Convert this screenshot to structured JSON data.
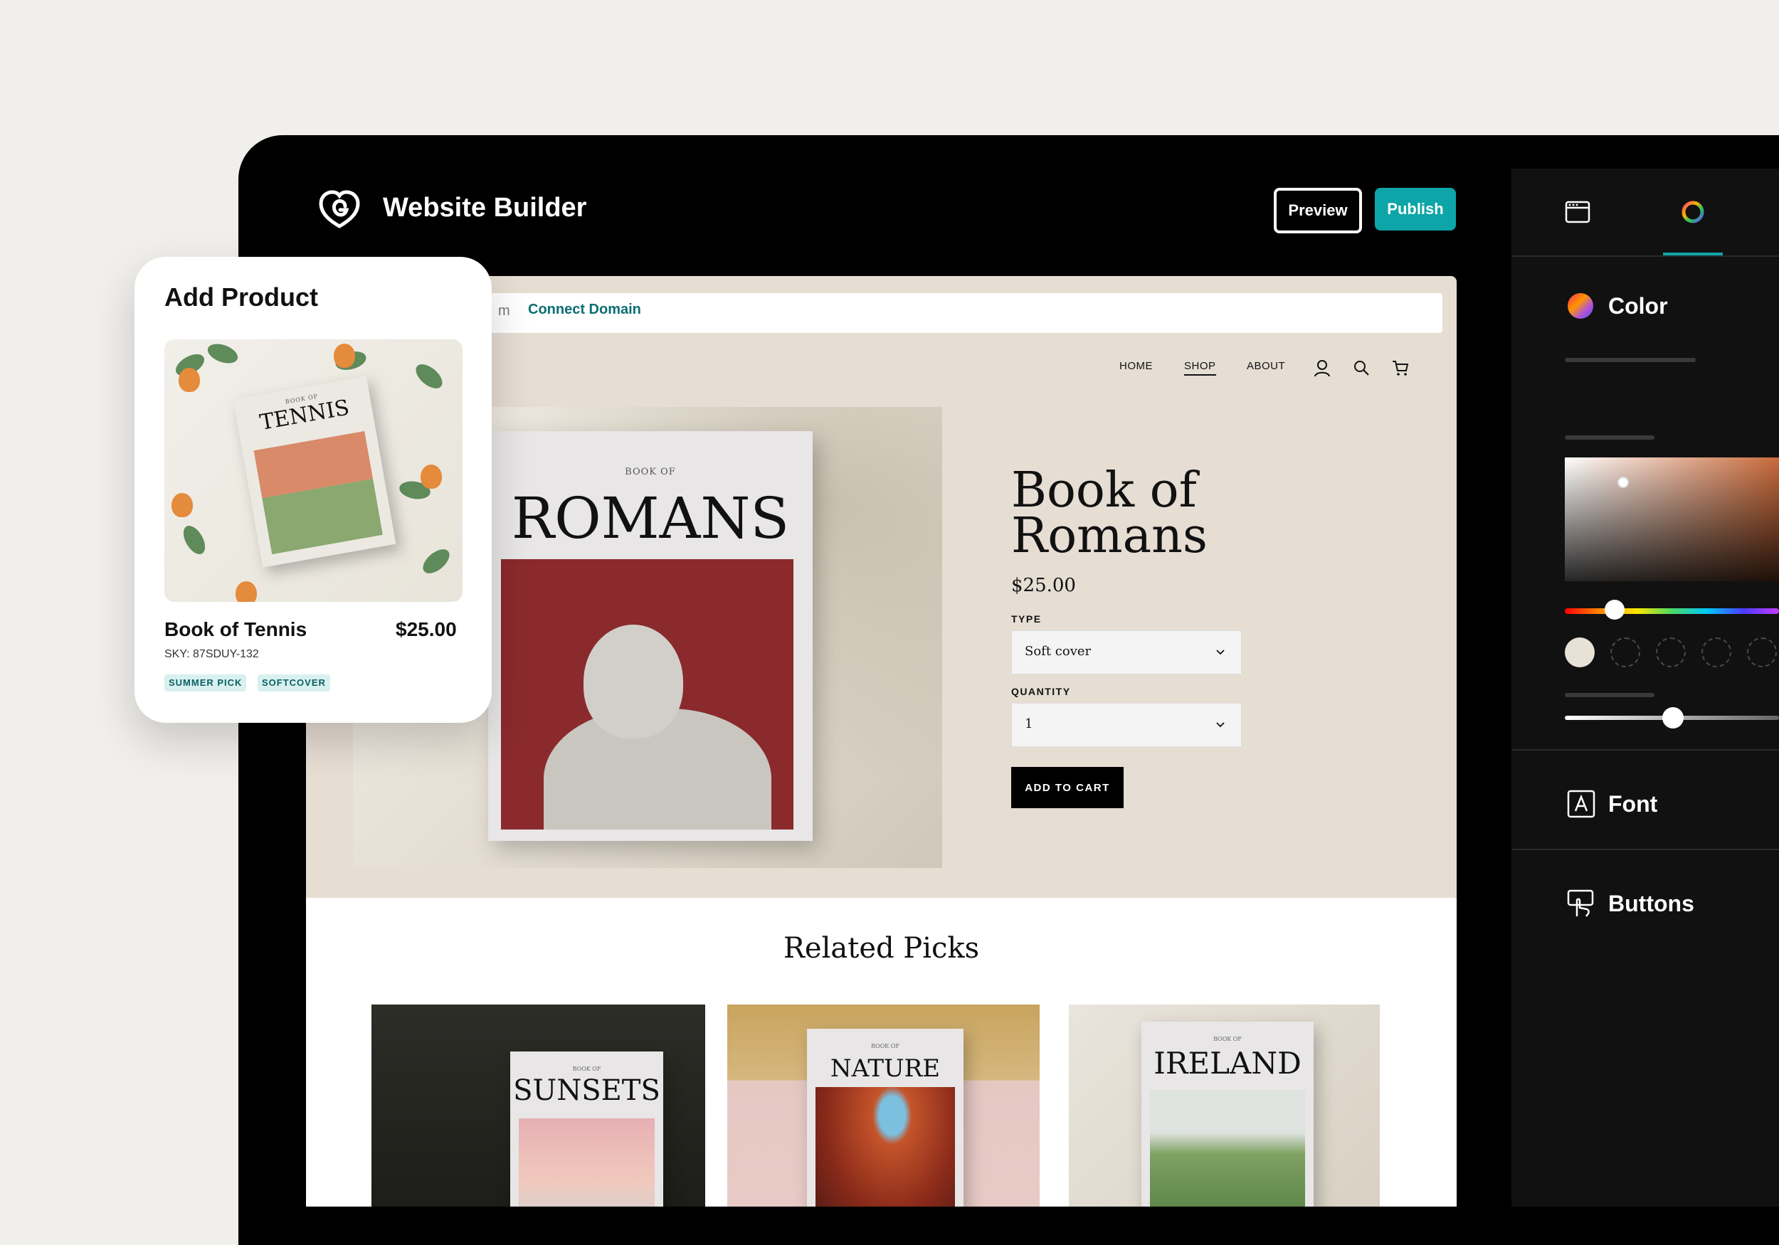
{
  "app": {
    "title": "Website Builder"
  },
  "toolbar": {
    "preview_label": "Preview",
    "publish_label": "Publish"
  },
  "panel": {
    "color_label": "Color",
    "font_label": "Font",
    "buttons_label": "Buttons",
    "swatches": [
      "#e8e1d6",
      "#7e2b33",
      "#d9b785",
      "#a59a7e",
      "#333333"
    ],
    "selected_swatch": "#e8e1d6",
    "accent": "#0ea5a8"
  },
  "site": {
    "url_partial": "m",
    "connect_domain": "Connect Domain",
    "nav": [
      "HOME",
      "SHOP",
      "ABOUT"
    ],
    "product": {
      "title_line1": "Book of",
      "title_line2": "Romans",
      "price": "$25.00",
      "type_label": "TYPE",
      "type_value": "Soft cover",
      "quantity_label": "QUANTITY",
      "quantity_value": "1",
      "add_to_cart": "ADD TO CART",
      "cover_small": "BOOK OF",
      "cover_title": "ROMANS"
    },
    "related": {
      "title": "Related Picks",
      "items": [
        {
          "small": "BOOK OF",
          "title": "SUNSETS"
        },
        {
          "small": "BOOK OF",
          "title": "NATURE"
        },
        {
          "small": "BOOK OF",
          "title": "IRELAND"
        }
      ]
    }
  },
  "add_product": {
    "title": "Add Product",
    "image_small": "BOOK OF",
    "image_title": "TENNIS",
    "name": "Book of Tennis",
    "price": "$25.00",
    "sku": "SKY: 87SDUY-132",
    "tags": [
      "SUMMER PICK",
      "SOFTCOVER"
    ]
  }
}
